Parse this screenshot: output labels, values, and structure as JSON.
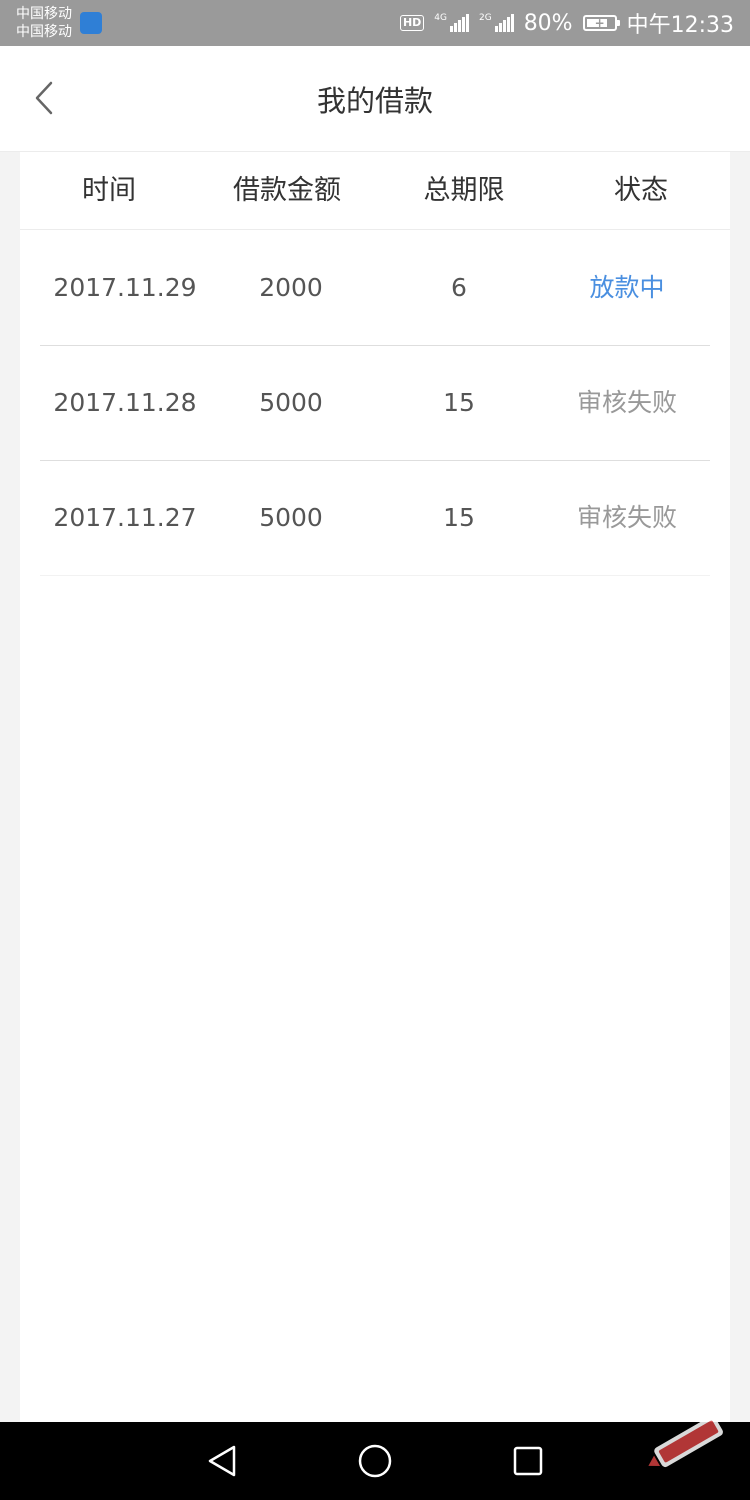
{
  "status_bar": {
    "carrier_1": "中国移动",
    "carrier_2": "中国移动",
    "hd_label": "HD",
    "network_1": "4G",
    "network_2": "2G",
    "battery_percent": "80%",
    "battery_level": 0.8,
    "time": "中午12:33"
  },
  "header": {
    "title": "我的借款",
    "back_icon": "chevron-left-icon"
  },
  "table": {
    "columns": [
      "时间",
      "借款金额",
      "总期限",
      "状态"
    ],
    "rows": [
      {
        "date": "2017.11.29",
        "amount": "2000",
        "term": "6",
        "status": "放款中",
        "status_type": "active"
      },
      {
        "date": "2017.11.28",
        "amount": "5000",
        "term": "15",
        "status": "审核失败",
        "status_type": "fail"
      },
      {
        "date": "2017.11.27",
        "amount": "5000",
        "term": "15",
        "status": "审核失败",
        "status_type": "fail"
      }
    ]
  },
  "colors": {
    "status_active": "#4a8fe0",
    "status_fail": "#999999"
  },
  "nav_bar": {
    "back_icon": "triangle-back-icon",
    "home_icon": "circle-home-icon",
    "recents_icon": "square-recents-icon"
  }
}
